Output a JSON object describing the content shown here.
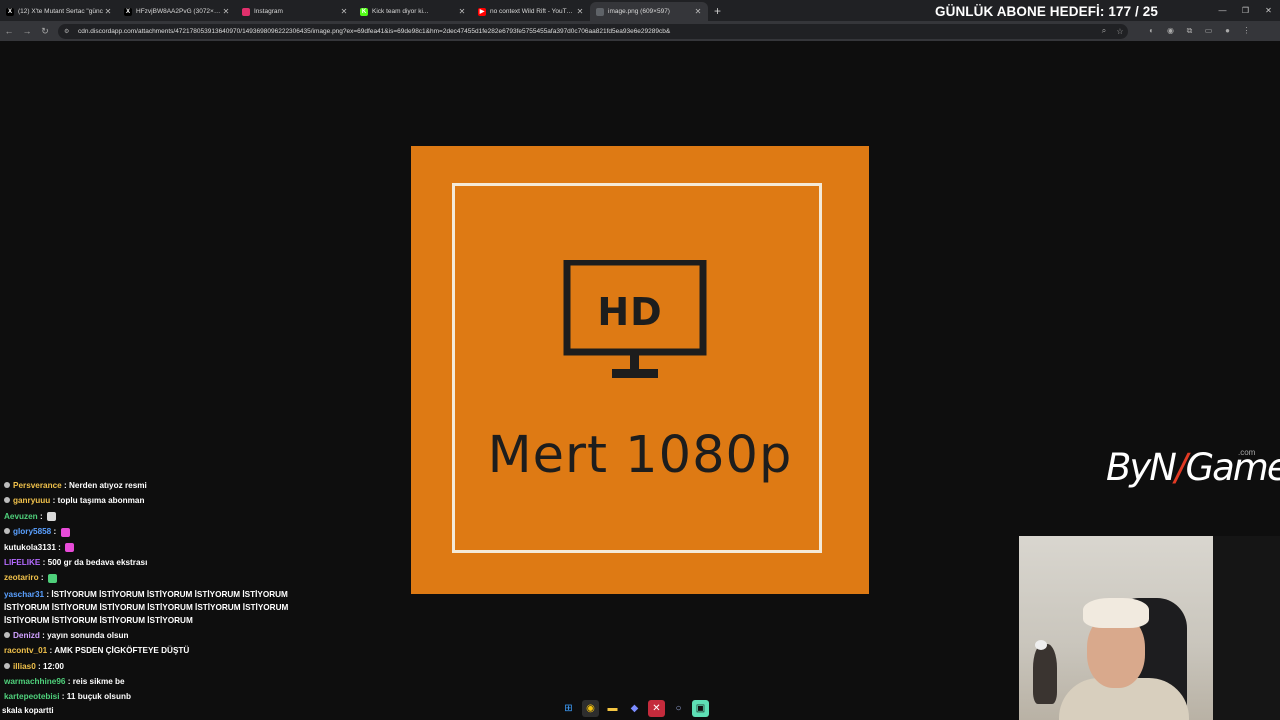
{
  "browser": {
    "tabs": [
      {
        "title": "(12) X'te Mutant Sertac \"günc",
        "icon_color": "#000000",
        "icon_glyph": "X"
      },
      {
        "title": "HFzvjBW8AA2PvG (3072×4096)",
        "icon_color": "#000000",
        "icon_glyph": "X"
      },
      {
        "title": "Instagram",
        "icon_color": "#e1306c",
        "icon_glyph": ""
      },
      {
        "title": "Kick team diyor ki...",
        "icon_color": "#53fc18",
        "icon_glyph": "K"
      },
      {
        "title": "no context Wild Rift - YouTube",
        "icon_color": "#ff0000",
        "icon_glyph": "▶"
      },
      {
        "title": "image.png (609×597)",
        "icon_color": "#5f6368",
        "icon_glyph": ""
      }
    ],
    "url": "cdn.discordapp.com/attachments/472178053913640970/1493698096222306435/image.png?ex=69dfea41&is=69de98c1&hm=2dec47455d1fe282e6793fe5755455afa397d0c706aa821fd5ea93e6e29289cb&"
  },
  "overlay": {
    "goal_text": "GÜNLÜK ABONE HEDEFİ: 177 / 25",
    "logo_text_a": "ByN",
    "logo_text_b": "Game",
    "logo_com": ".com"
  },
  "image": {
    "monitor_label": "HD",
    "caption": "Mert 1080p",
    "background_color": "#de7a14"
  },
  "chat": {
    "messages": [
      {
        "user": "Persverance",
        "color": "#f0c14b",
        "text": "Nerden atıyoz resmi",
        "badge": true
      },
      {
        "user": "ganryuuu",
        "color": "#f0c14b",
        "text": "toplu taşıma abonman",
        "badge": true
      },
      {
        "user": "Aevuzen",
        "color": "#4fd07b",
        "text": "",
        "emote": "#d9d9d9"
      },
      {
        "user": "glory5858",
        "color": "#5aa0ff",
        "text": "",
        "badge": true,
        "emote": "#e84bd8"
      },
      {
        "user": "kutukola3131",
        "color": "#ffffff",
        "text": "",
        "emote": "#e84bd8"
      },
      {
        "user": "LIFELIKE",
        "color": "#b56bff",
        "text": "500 gr da bedava ekstrası"
      },
      {
        "user": "zeotariro",
        "color": "#f0c14b",
        "text": "",
        "emote": "#4fd07b"
      },
      {
        "user": "yaschar31",
        "color": "#5aa0ff",
        "text": "İSTİYORUM İSTİYORUM İSTİYORUM İSTİYORUM İSTİYORUM İSTİYORUM İSTİYORUM İSTİYORUM İSTİYORUM İSTİYORUM İSTİYORUM İSTİYORUM İSTİYORUM İSTİYORUM İSTİYORUM",
        "multi": true
      },
      {
        "user": "Denizd",
        "color": "#d0a0ff",
        "text": "yayın sonunda olsun",
        "badge": true
      },
      {
        "user": "racontv_01",
        "color": "#f0c14b",
        "text": "AMK PSDEN ÇİGKÖFTEYE DÜŞTÜ"
      },
      {
        "user": "illias0",
        "color": "#f0c14b",
        "text": "12:00",
        "badge": true
      },
      {
        "user": "warmachhine96",
        "color": "#4fd07b",
        "text": "reis sikme be"
      },
      {
        "user": "kartepeotebisi",
        "color": "#4fd07b",
        "text": "11 buçuk olsunb"
      }
    ],
    "input_text": "skala kopartti"
  }
}
